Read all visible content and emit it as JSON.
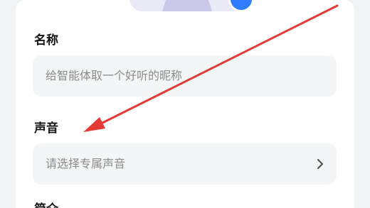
{
  "form": {
    "name_label": "名称",
    "name_placeholder": "给智能体取一个好听的昵称",
    "voice_label": "声音",
    "voice_placeholder": "请选择专属声音",
    "next_label": "简介"
  },
  "icons": {
    "avatar": "avatar-placeholder-icon",
    "add": "add-icon",
    "chevron": "chevron-right-icon",
    "annotation": "red-arrow-annotation"
  },
  "colors": {
    "accent": "#2f7cff",
    "annotation": "#e53935",
    "placeholder_text": "#8a8a8f",
    "field_bg": "#f4f5f7"
  }
}
